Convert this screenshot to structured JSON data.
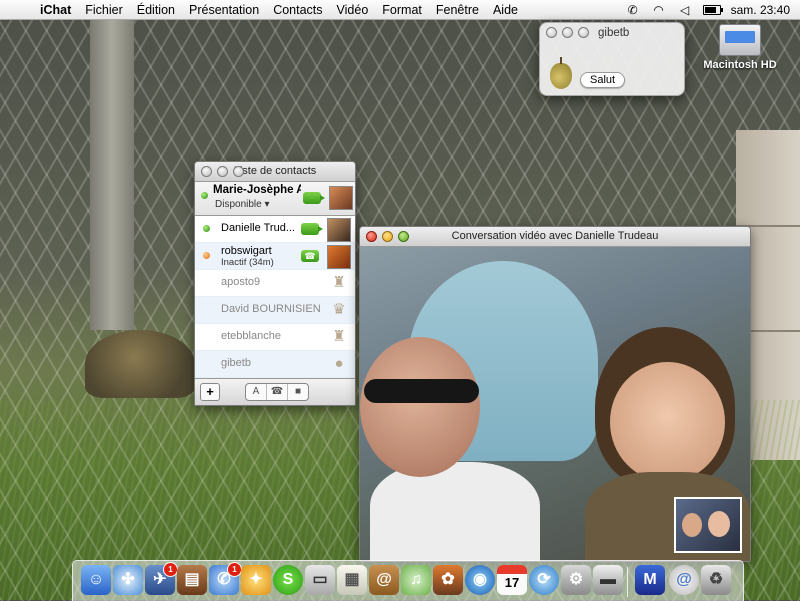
{
  "menubar": {
    "app_name": "iChat",
    "menus": [
      "Fichier",
      "Édition",
      "Présentation",
      "Contacts",
      "Vidéo",
      "Format",
      "Fenêtre",
      "Aide"
    ],
    "clock": "sam. 23:40"
  },
  "desktop": {
    "hd_label": "Macintosh HD"
  },
  "gibetb_window": {
    "title": "gibetb",
    "message": "Salut"
  },
  "buddy_list": {
    "title": "Liste de contacts",
    "me": {
      "name": "Marie-Josèphe A...",
      "status": "Disponible"
    },
    "contacts": [
      {
        "name": "Danielle Trud...",
        "status": "",
        "state": "available"
      },
      {
        "name": "robswigart",
        "status": "Inactif (34m)",
        "state": "idle"
      },
      {
        "name": "aposto9",
        "status": "",
        "state": "offline"
      },
      {
        "name": "David BOURNISIEN",
        "status": "",
        "state": "offline"
      },
      {
        "name": "etebblanche",
        "status": "",
        "state": "offline"
      },
      {
        "name": "gibetb",
        "status": "",
        "state": "offline"
      }
    ],
    "footer": {
      "add": "+",
      "text_btn": "A"
    }
  },
  "video_window": {
    "title": "Conversation vidéo avec Danielle Trudeau"
  },
  "dock": {
    "badges": {
      "ical": "1",
      "ichat": "1"
    },
    "calendar_day": "17",
    "items": [
      "Finder",
      "Safari",
      "Mail",
      "Scanner",
      "iChat",
      "Adium",
      "Skype",
      "Moniteur",
      "Aperçu",
      "Carnet d'adresses",
      "iTunes",
      "iPhoto",
      "Globe",
      "iCal",
      "Mise à jour",
      "Préférences",
      "Imprimer",
      "Mail perso",
      "Corbeille email",
      "Corbeille"
    ]
  },
  "colors": {
    "accent": "#3a9a18",
    "badge": "#e02010"
  }
}
